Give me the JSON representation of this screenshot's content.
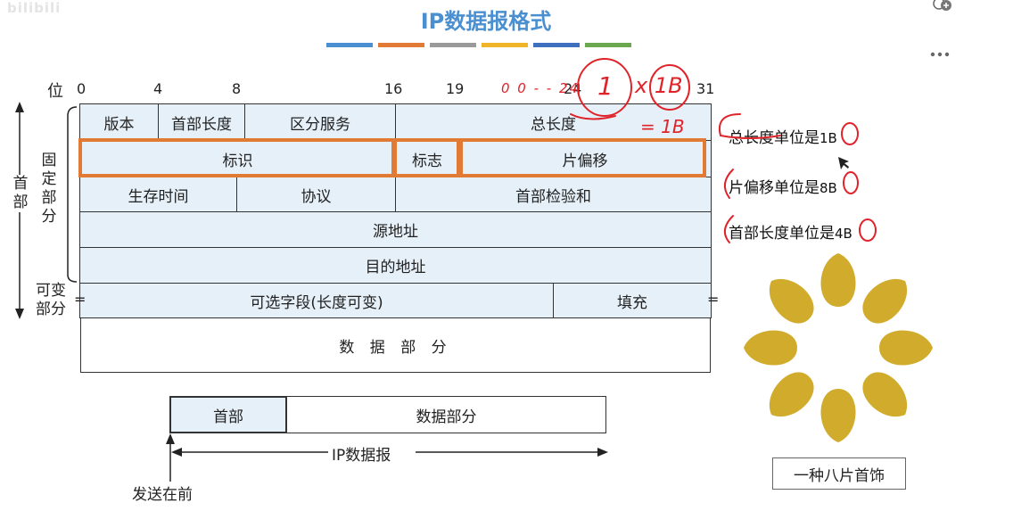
{
  "watermark": "bilibili",
  "title": "IP数据报格式",
  "title_bar_colors": [
    "#4a8fd0",
    "#e07a35",
    "#9a9a9a",
    "#f0b429",
    "#3f6fbf",
    "#6aa84f"
  ],
  "top_icons": [
    "add-circle-icon",
    "more-icon"
  ],
  "bit_positions": {
    "label": "位",
    "marks": [
      "0",
      "4",
      "8",
      "16",
      "19",
      "24",
      "31"
    ]
  },
  "side_labels": {
    "header": "首部",
    "fixed": "固定部分",
    "variable": "可变部分",
    "fixed_chars": [
      "固",
      "定",
      "部",
      "分"
    ]
  },
  "fields": {
    "version": "版本",
    "header_length": "首部长度",
    "diff_services": "区分服务",
    "total_length": "总长度",
    "identification": "标识",
    "flags": "标志",
    "fragment_offset": "片偏移",
    "ttl": "生存时间",
    "protocol": "协议",
    "header_checksum": "首部检验和",
    "source_address": "源地址",
    "dest_address": "目的地址",
    "options": "可选字段(长度可变)",
    "padding": "填充",
    "data": "数 据 部 分",
    "eq_mark": "="
  },
  "datagram": {
    "header": "首部",
    "data": "数据部分",
    "label": "IP数据报",
    "send_first": "发送在前"
  },
  "notes": [
    {
      "text": "总长度单位是",
      "unit": "1B"
    },
    {
      "text": "片偏移单位是",
      "unit": "8B"
    },
    {
      "text": "首部长度单位是",
      "unit": "4B"
    }
  ],
  "handwriting": {
    "a": "0 0 - - 24",
    "b": "1",
    "c": "x 1B",
    "d": "= 1B"
  },
  "flower_caption": "一种八片首饰",
  "colors": {
    "accent": "#4a8fd0",
    "highlight": "#e07a35",
    "ink": "#e0232a",
    "petal": "#d1ac2c",
    "cell": "#e6f0f8"
  }
}
